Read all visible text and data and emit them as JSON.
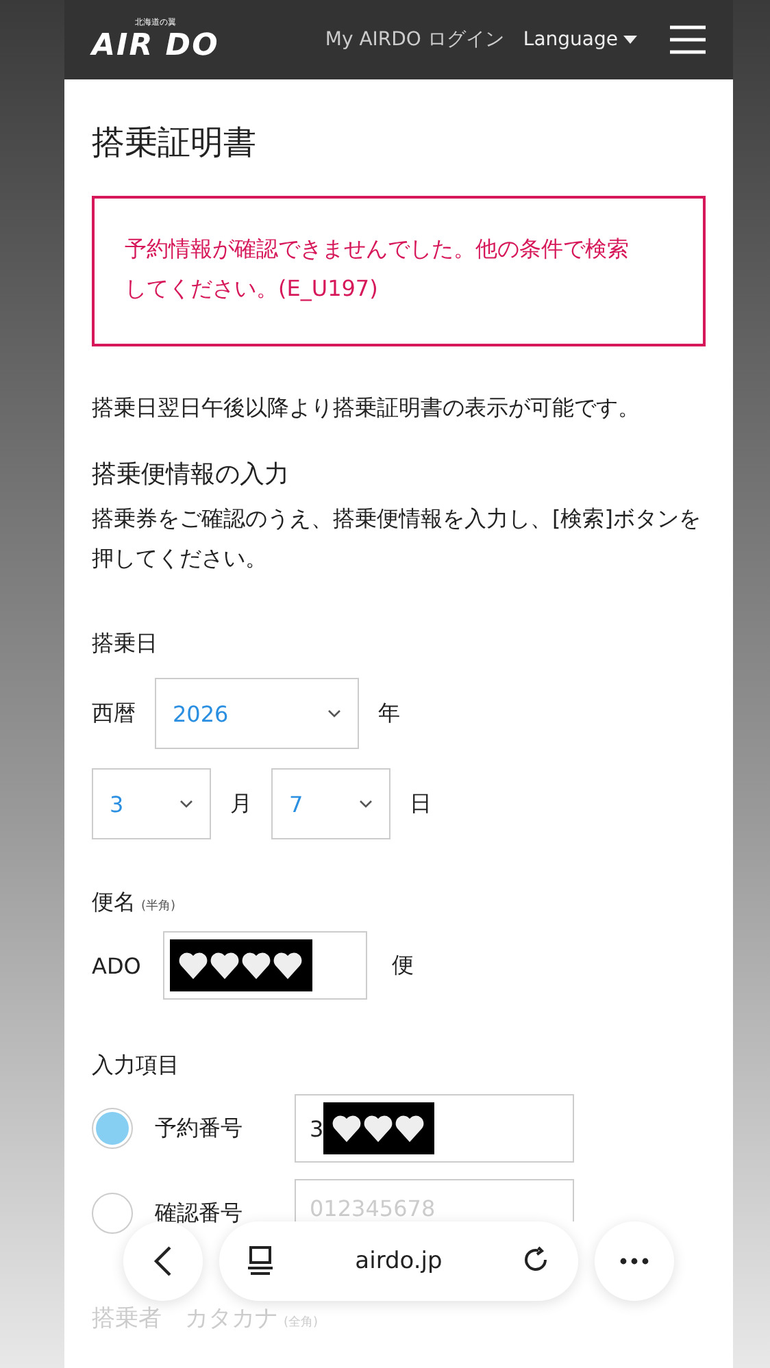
{
  "header": {
    "logo_small": "北海道の翼",
    "logo": "AIR DO",
    "login": "My AIRDO ログイン",
    "language": "Language"
  },
  "title": "搭乗証明書",
  "error": "予約情報が確認できませんでした。他の条件で検索してください。(E_U197)",
  "notice": "搭乗日翌日午後以降より搭乗証明書の表示が可能です。",
  "section_title": "搭乗便情報の入力",
  "instructions": "搭乗券をご確認のうえ、搭乗便情報を入力し、[検索]ボタンを押してください。",
  "date": {
    "label": "搭乗日",
    "era": "西暦",
    "year": "2026",
    "year_unit": "年",
    "month": "3",
    "month_unit": "月",
    "day": "7",
    "day_unit": "日"
  },
  "flight": {
    "label": "便名",
    "hint": "(半角)",
    "prefix": "ADO",
    "suffix": "便"
  },
  "input_items": {
    "label": "入力項目",
    "options": [
      {
        "label": "予約番号",
        "selected": true,
        "value": "3"
      },
      {
        "label": "確認番号",
        "selected": false,
        "placeholder": "012345678"
      }
    ]
  },
  "next_section": {
    "label": "搭乗者　カタカナ",
    "hint": "(全角)"
  },
  "browser_bar": {
    "url": "airdo.jp"
  }
}
